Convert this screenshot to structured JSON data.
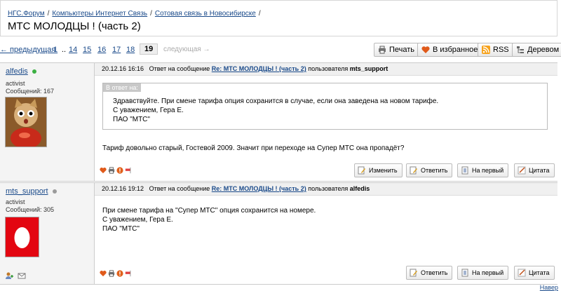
{
  "breadcrumbs": [
    "НГС.Форум",
    "Компьютеры Интернет Связь",
    "Сотовая связь в Новосибирске"
  ],
  "page_title": "МТС МОЛОДЦЫ ! (часть 2)",
  "pager": {
    "prev": "← предыдущая",
    "pages": [
      "1",
      "..",
      "14",
      "15",
      "16",
      "17",
      "18"
    ],
    "current": "19",
    "next": "следующая →"
  },
  "toolbar": {
    "print": "Печать",
    "favorites": "В избранное",
    "rss": "RSS",
    "tree": "Деревом"
  },
  "posts": [
    {
      "author": "alfedis",
      "status_color": "#3cb043",
      "role": "activist",
      "messages": "Сообщений: 167",
      "date": "20.12.16 16:16",
      "reply_prefix": "Ответ на сообщение",
      "reply_topic": "Re: МТС МОЛОДЦЫ ! (часть 2)",
      "reply_user_prefix": "пользователя",
      "reply_user": "mts_support",
      "quote_label": "В ответ на:",
      "quote_lines": [
        "Здравствуйте. При смене тарифа опция сохранится в случае, если она заведена на новом тарифе.",
        "С уважением, Гера Е.",
        "ПАО \"МТС\""
      ],
      "body_lines": [
        "Тариф довольно старый, Гостевой 2009. Значит при переходе на Супер МТС она пропадёт?"
      ],
      "buttons": [
        "Изменить",
        "Ответить",
        "На первый",
        "Цитата"
      ]
    },
    {
      "author": "mts_support",
      "status_color": "#9a9a9a",
      "role": "activist",
      "messages": "Сообщений: 305",
      "date": "20.12.16 19:12",
      "reply_prefix": "Ответ на сообщение",
      "reply_topic": "Re: МТС МОЛОДЦЫ ! (часть 2)",
      "reply_user_prefix": "пользователя",
      "reply_user": "alfedis",
      "body_lines": [
        "При смене тарифа на \"Супер МТС\" опция сохранится на номере.",
        "С уважением, Гера Е.",
        "ПАО \"МТС\""
      ],
      "buttons": [
        "Ответить",
        "На первый",
        "Цитата"
      ]
    }
  ],
  "footer_link": "Навер"
}
